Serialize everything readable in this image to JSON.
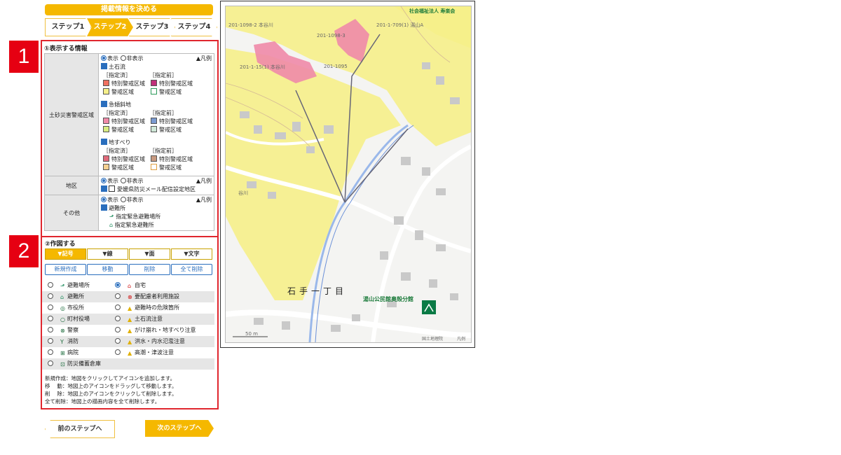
{
  "header": {
    "title": "掲載情報を決める"
  },
  "steps": [
    "ステップ1",
    "ステップ2",
    "ステップ3",
    "ステップ4"
  ],
  "badges": {
    "one": "1",
    "two": "2"
  },
  "info": {
    "title": "①表示する情報",
    "legend": "▲凡例",
    "show": "表示",
    "hide": "非表示",
    "sediment": {
      "label": "土砂災害警戒区域",
      "debris_flow": "土石流",
      "steep_slope": "急傾斜地",
      "landslide": "地すべり",
      "designated": "［指定済］",
      "pre_designated": "［指定前］",
      "special_zone": "特別警戒区域",
      "zone": "警戒区域"
    },
    "area": {
      "label": "地区",
      "item": "愛媛県防災メール配信設定地区"
    },
    "other": {
      "label": "その他",
      "shelter": "避難所",
      "emergency_place": "指定緊急避難場所",
      "emergency_shelter": "指定緊急避難所"
    }
  },
  "draw": {
    "title": "②作図する",
    "tabs": [
      "▼記号",
      "▼線",
      "▼面",
      "▼文字"
    ],
    "buttons": [
      "新規作成",
      "移動",
      "削除",
      "全て削除"
    ],
    "icons_left": [
      "避難場所",
      "避難所",
      "市役所",
      "町村役場",
      "警察",
      "消防",
      "病院",
      "防災備蓄倉庫"
    ],
    "icons_right": [
      "自宅",
      "要配慮者利用施設",
      "避難時の危険箇所",
      "土石流注意",
      "がけ崩れ・地すべり注意",
      "洪水・内水氾濫注意",
      "高潮・津波注意"
    ],
    "notes": [
      "新規作成：地図をクリックしてアイコンを追加します。",
      "移　 動：地図上のアイコンをドラッグして移動します。",
      "削　 除：地図上のアイコンをクリックして削除します。",
      "全て削除：地図上の描画内容を全て削除します。"
    ]
  },
  "nav": {
    "prev": "前のステップへ",
    "next": "次のステップへ"
  },
  "map": {
    "corner_label": "社会福祉法人 寿楽会",
    "labels": [
      "201-1098-2 本谷川",
      "201-1098-3",
      "201-1-709(1) 湯山A",
      "201-1-15(1) 本谷川",
      "201-1095",
      "谷川"
    ],
    "district": "石手一丁目",
    "facility": "湯山公民館奥殻分館",
    "scale": "50 m",
    "credit": "国土地理院",
    "legend_link": "凡例"
  },
  "colors": {
    "accent": "#f5b800",
    "badge": "#e60012",
    "hazard_yellow": "#f6f08a",
    "hazard_pink": "#f08aa8"
  }
}
